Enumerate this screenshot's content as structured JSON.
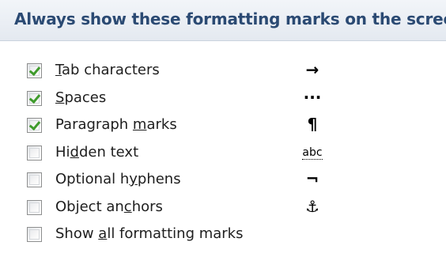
{
  "section": {
    "title": "Always show these formatting marks on the screen"
  },
  "options": [
    {
      "label_pre": "",
      "mnemonic": "T",
      "label_post": "ab characters",
      "checked": true,
      "symbol": "→",
      "symbol_icon": "tab-arrow-icon"
    },
    {
      "label_pre": "",
      "mnemonic": "S",
      "label_post": "paces",
      "checked": true,
      "symbol": "···",
      "symbol_icon": "space-dots-icon"
    },
    {
      "label_pre": "Paragraph ",
      "mnemonic": "m",
      "label_post": "arks",
      "checked": true,
      "symbol": "¶",
      "symbol_icon": "pilcrow-icon"
    },
    {
      "label_pre": "Hi",
      "mnemonic": "d",
      "label_post": "den text",
      "checked": false,
      "symbol": "abc",
      "symbol_icon": "hidden-text-icon"
    },
    {
      "label_pre": "Optional h",
      "mnemonic": "y",
      "label_post": "phens",
      "checked": false,
      "symbol": "¬",
      "symbol_icon": "optional-hyphen-icon"
    },
    {
      "label_pre": "Object an",
      "mnemonic": "c",
      "label_post": "hors",
      "checked": false,
      "symbol": "⚓",
      "symbol_icon": "anchor-icon"
    },
    {
      "label_pre": "Show ",
      "mnemonic": "a",
      "label_post": "ll formatting marks",
      "checked": false,
      "symbol": "",
      "symbol_icon": ""
    }
  ],
  "colors": {
    "title": "#2b4a73",
    "checkmark": "#3f9b2c",
    "header_bg": "#e4e9f0"
  }
}
